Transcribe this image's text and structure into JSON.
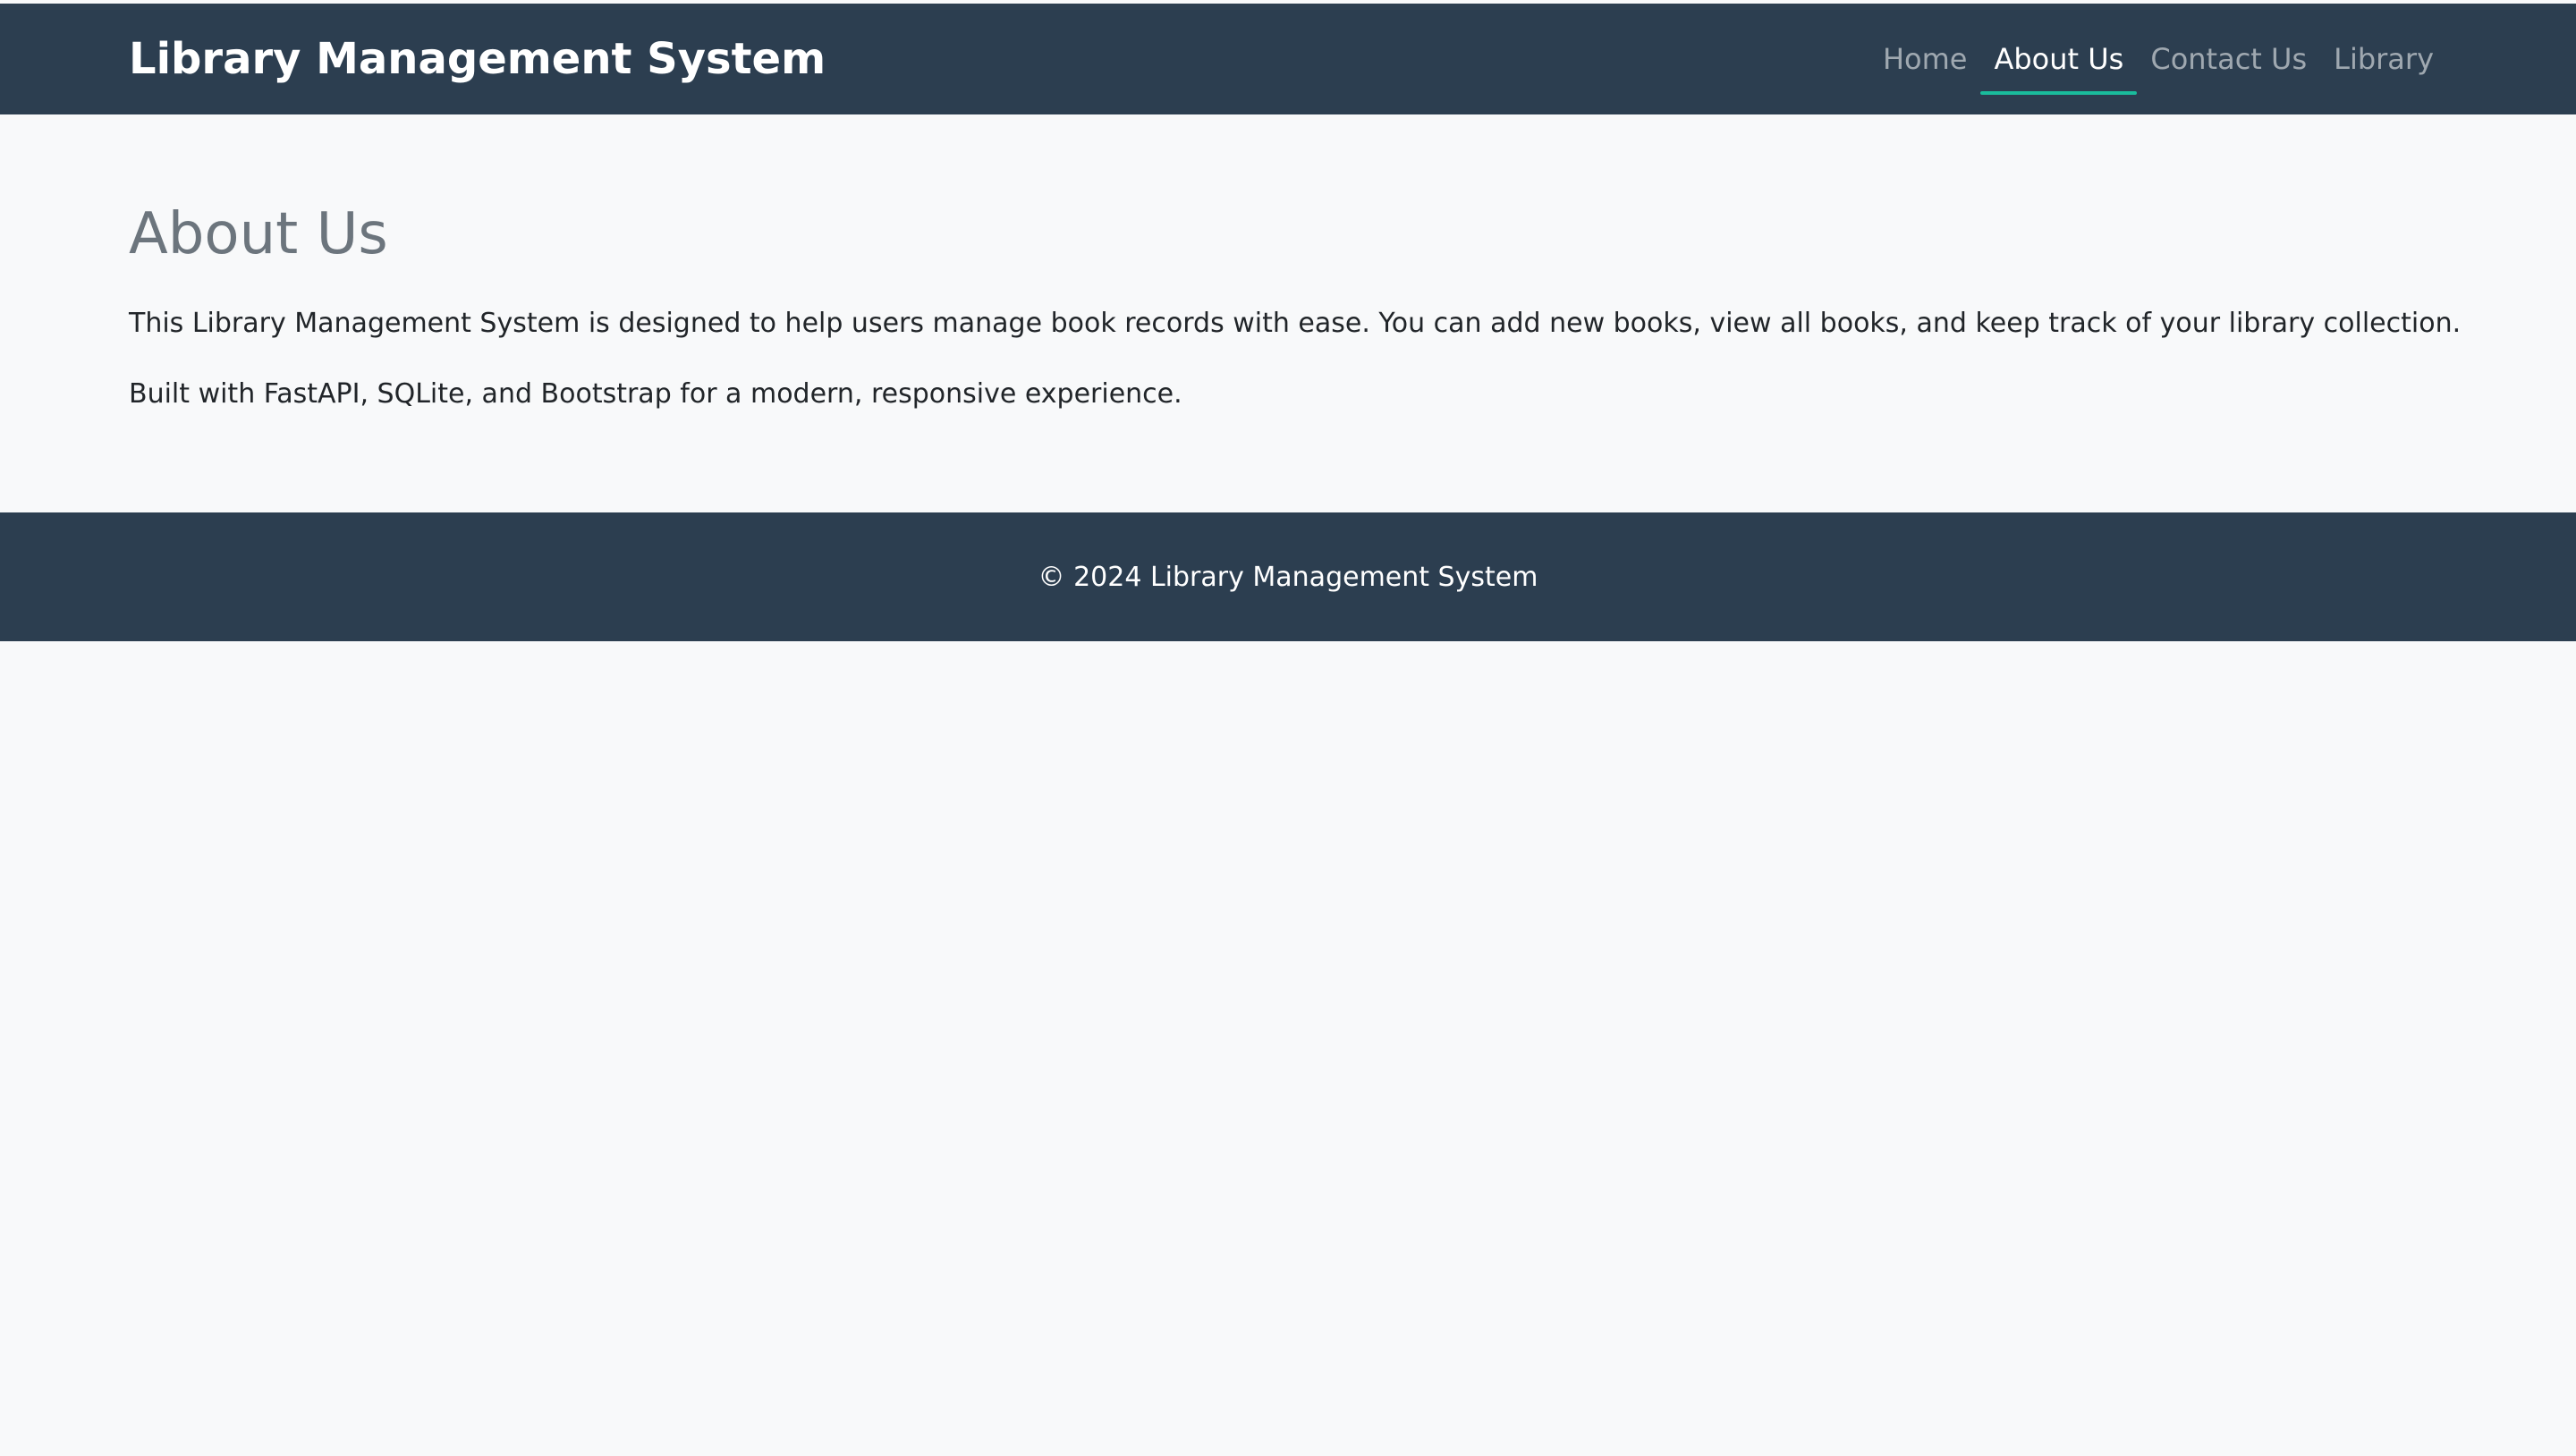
{
  "navbar": {
    "brand": "Library Management System",
    "links": [
      {
        "label": "Home",
        "active": false
      },
      {
        "label": "About Us",
        "active": true
      },
      {
        "label": "Contact Us",
        "active": false
      },
      {
        "label": "Library",
        "active": false
      }
    ]
  },
  "main": {
    "title": "About Us",
    "paragraphs": [
      "This Library Management System is designed to help users manage book records with ease. You can add new books, view all books, and keep track of your library collection.",
      "Built with FastAPI, SQLite, and Bootstrap for a modern, responsive experience."
    ]
  },
  "footer": {
    "text": "© 2024 Library Management System"
  },
  "colors": {
    "navbar_bg": "#2c3e50",
    "active_underline": "#1abc9c",
    "page_bg": "#f8f9fa",
    "title": "#6c757d"
  }
}
